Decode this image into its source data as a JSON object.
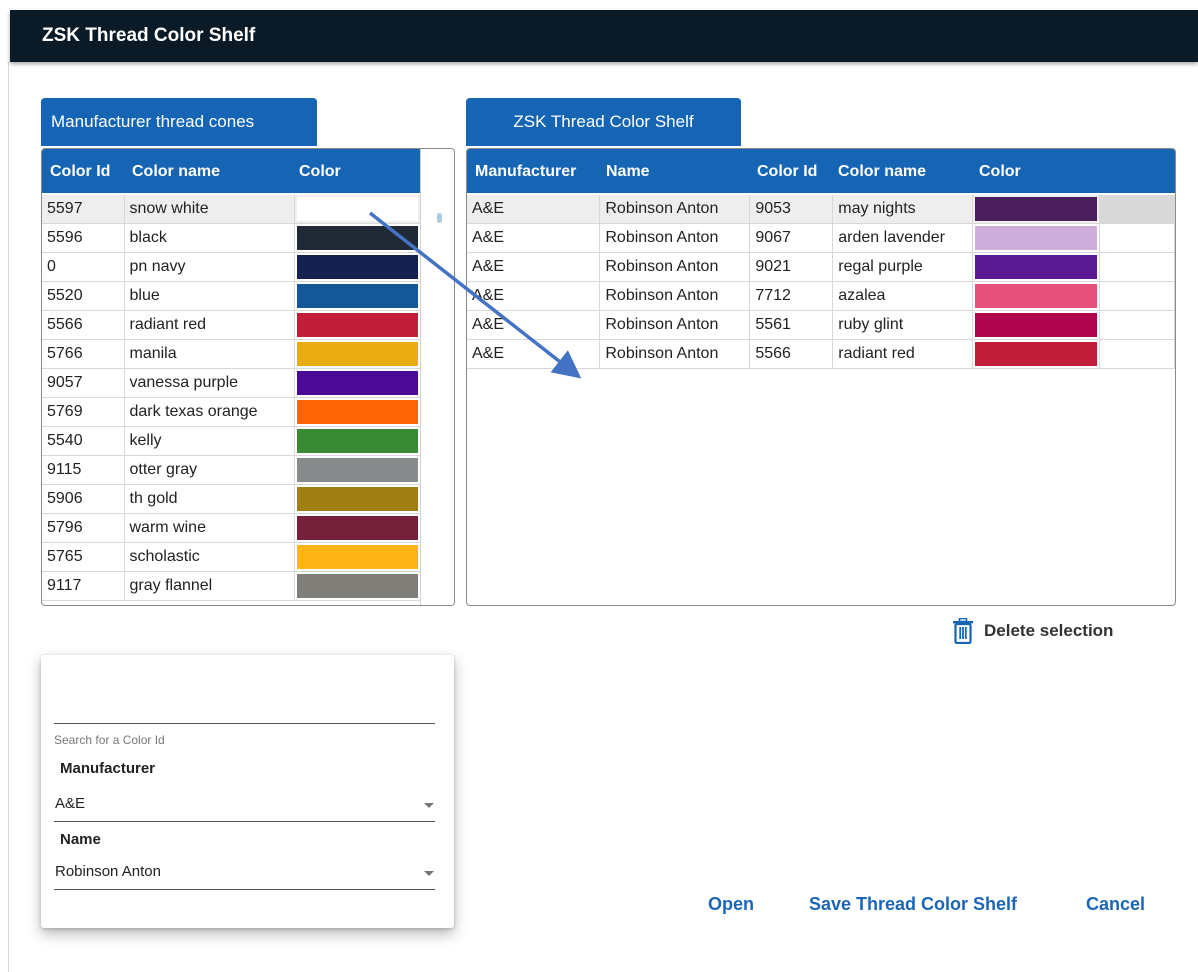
{
  "window": {
    "title": "ZSK Thread Color Shelf"
  },
  "left_tab": {
    "label": "Manufacturer thread cones"
  },
  "right_tab": {
    "label": "ZSK Thread Color Shelf"
  },
  "left_table": {
    "columns": [
      "Color Id",
      "Color name",
      "Color"
    ],
    "rows": [
      {
        "id": "5597",
        "name": "snow white",
        "color": "#ffffff"
      },
      {
        "id": "5596",
        "name": "black",
        "color": "#1f2a36"
      },
      {
        "id": "0",
        "name": "pn navy",
        "color": "#15214f"
      },
      {
        "id": "5520",
        "name": "blue",
        "color": "#14589a"
      },
      {
        "id": "5566",
        "name": "radiant red",
        "color": "#c21d3a"
      },
      {
        "id": "5766",
        "name": "manila",
        "color": "#e9ad12"
      },
      {
        "id": "9057",
        "name": "vanessa purple",
        "color": "#4a0a96"
      },
      {
        "id": "5769",
        "name": "dark texas orange",
        "color": "#ff6407"
      },
      {
        "id": "5540",
        "name": "kelly",
        "color": "#3a8a35"
      },
      {
        "id": "9115",
        "name": "otter gray",
        "color": "#888b8c"
      },
      {
        "id": "5906",
        "name": "th gold",
        "color": "#a07e14"
      },
      {
        "id": "5796",
        "name": "warm wine",
        "color": "#75213c"
      },
      {
        "id": "5765",
        "name": "scholastic",
        "color": "#ffb516"
      },
      {
        "id": "9117",
        "name": "gray flannel",
        "color": "#807e78"
      }
    ]
  },
  "right_table": {
    "columns": [
      "Manufacturer",
      "Name",
      "Color Id",
      "Color name",
      "Color"
    ],
    "rows": [
      {
        "manufacturer": "A&E",
        "name": "Robinson Anton",
        "id": "9053",
        "color_name": "may nights",
        "color": "#4a1f5c"
      },
      {
        "manufacturer": "A&E",
        "name": "Robinson Anton",
        "id": "9067",
        "color_name": "arden lavender",
        "color": "#cdaedb"
      },
      {
        "manufacturer": "A&E",
        "name": "Robinson Anton",
        "id": "9021",
        "color_name": "regal purple",
        "color": "#5a1a94"
      },
      {
        "manufacturer": "A&E",
        "name": "Robinson Anton",
        "id": "7712",
        "color_name": "azalea",
        "color": "#e4507a"
      },
      {
        "manufacturer": "A&E",
        "name": "Robinson Anton",
        "id": "5561",
        "color_name": "ruby glint",
        "color": "#b0064e"
      },
      {
        "manufacturer": "A&E",
        "name": "Robinson Anton",
        "id": "5566",
        "color_name": "radiant red",
        "color": "#c21d3a"
      }
    ]
  },
  "delete_button": {
    "label": "Delete selection"
  },
  "search": {
    "input_value": "",
    "input_label": "Search for a Color Id",
    "manufacturer_label": "Manufacturer",
    "manufacturer_value": "A&E",
    "name_label": "Name",
    "name_value": "Robinson Anton"
  },
  "footer": {
    "open_label": "Open",
    "save_label": "Save Thread Color Shelf",
    "cancel_label": "Cancel"
  },
  "colors": {
    "accent": "#1565b4",
    "titlebar": "#0a1a26",
    "link": "#1b66b8",
    "drag_arrow": "#4472c4"
  }
}
